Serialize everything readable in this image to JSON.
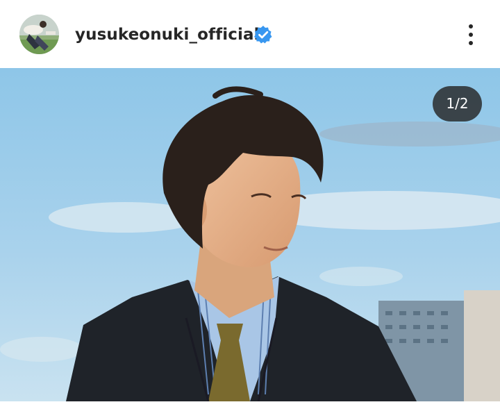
{
  "post": {
    "username": "yusukeonuki_official",
    "verified": true,
    "media_counter": "1/2"
  },
  "icons": {
    "avatar": "profile-photo",
    "verified": "verified-badge-icon",
    "more": "more-options-icon"
  },
  "colors": {
    "verified_badge": "#3897f0",
    "username_text": "#262626",
    "counter_bg": "#262626"
  }
}
